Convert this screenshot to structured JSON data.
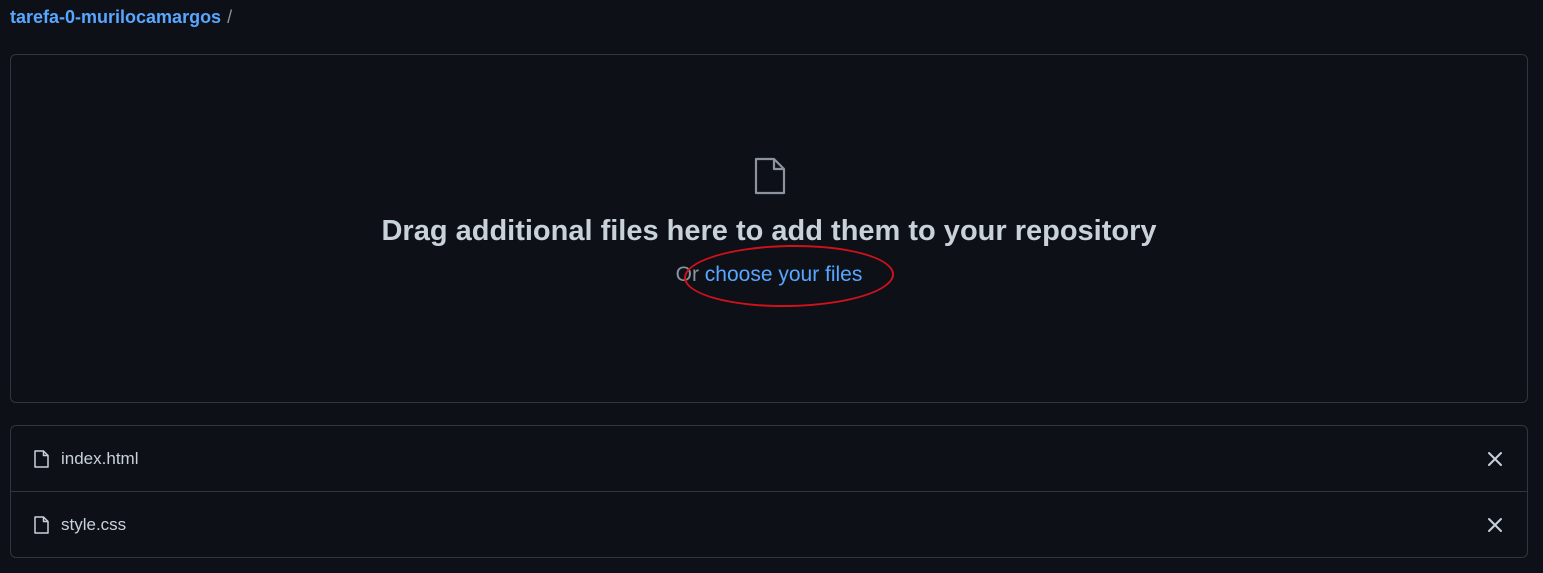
{
  "breadcrumb": {
    "repo": "tarefa-0-murilocamargos",
    "separator": "/"
  },
  "dropzone": {
    "icon": "file-icon",
    "title": "Drag additional files here to add them to your repository",
    "prefix": "Or ",
    "choose_link": "choose your files"
  },
  "files": [
    {
      "name": "index.html",
      "icon": "file-icon",
      "remove_icon": "close-icon"
    },
    {
      "name": "style.css",
      "icon": "file-icon",
      "remove_icon": "close-icon"
    }
  ],
  "colors": {
    "background": "#0d1117",
    "border": "#30363d",
    "text": "#c9d1d9",
    "muted": "#8b949e",
    "link": "#58a6ff",
    "annotation": "#d0111b"
  }
}
